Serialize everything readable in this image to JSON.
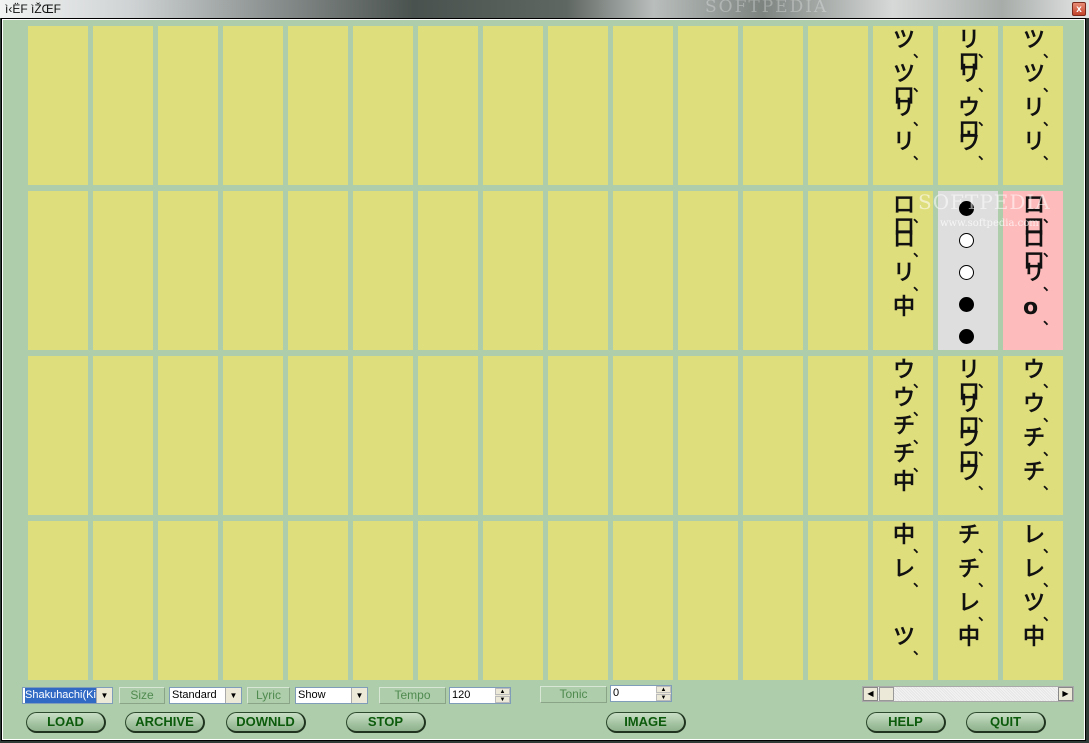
{
  "window": {
    "title": "ì‹ËF ìŽŒF",
    "close_label": "x",
    "watermark": "SOFTPEDIA"
  },
  "grid": {
    "columns": 16,
    "rows": 4,
    "cell_color": "#dfde7c",
    "highlight_colors": {
      "fingering": "#dedede",
      "current": "#febbbb"
    },
    "notation": [
      {
        "row": 0,
        "col": 13,
        "lines": [
          [
            "ツ",
            "、"
          ],
          [
            "ツロ",
            "、"
          ],
          [
            "リ",
            "、"
          ],
          [
            "リ",
            "、"
          ]
        ]
      },
      {
        "row": 0,
        "col": 14,
        "lines": [
          [
            "リロ",
            "、"
          ],
          [
            "リ",
            "、"
          ],
          [
            "ウロ",
            "、"
          ],
          [
            "ウ",
            "、"
          ]
        ]
      },
      {
        "row": 0,
        "col": 15,
        "lines": [
          [
            "ツ",
            "、"
          ],
          [
            "ツ",
            "、"
          ],
          [
            "リ",
            "、"
          ],
          [
            "リ",
            "、"
          ]
        ]
      },
      {
        "row": 1,
        "col": 13,
        "lines": [
          [
            "ロロ",
            "、"
          ],
          [
            "ロ",
            "、"
          ],
          [
            "リ",
            "、"
          ],
          [
            "中",
            ""
          ]
        ]
      },
      {
        "row": 1,
        "col": 15,
        "lines": [
          [
            "ロロ",
            "、"
          ],
          [
            "ロロ",
            "、"
          ],
          [
            "リ",
            "、"
          ],
          [
            "o",
            "、"
          ]
        ]
      },
      {
        "row": 2,
        "col": 13,
        "lines": [
          [
            "ウ",
            "、"
          ],
          [
            "ウ",
            "、"
          ],
          [
            "チ",
            "、"
          ],
          [
            "チ",
            "、"
          ],
          [
            "中",
            ""
          ]
        ]
      },
      {
        "row": 2,
        "col": 14,
        "lines": [
          [
            "リロ",
            "、"
          ],
          [
            "リロ",
            "、"
          ],
          [
            "ウロ",
            "、"
          ],
          [
            "ウ",
            "、"
          ]
        ]
      },
      {
        "row": 2,
        "col": 15,
        "lines": [
          [
            "ウ",
            "、"
          ],
          [
            "ウ",
            "、"
          ],
          [
            "チ",
            "、"
          ],
          [
            "チ",
            "、"
          ]
        ]
      },
      {
        "row": 3,
        "col": 13,
        "lines": [
          [
            "中",
            "、"
          ],
          [
            "レ",
            "、"
          ],
          [
            "",
            ""
          ],
          [
            "ツ",
            "、"
          ]
        ]
      },
      {
        "row": 3,
        "col": 14,
        "lines": [
          [
            "チ",
            "、"
          ],
          [
            "チ",
            "、"
          ],
          [
            "レ",
            "、"
          ],
          [
            "中",
            ""
          ]
        ]
      },
      {
        "row": 3,
        "col": 15,
        "lines": [
          [
            "レ",
            "、"
          ],
          [
            "レ",
            "、"
          ],
          [
            "ツ",
            "、"
          ],
          [
            "中",
            ""
          ]
        ]
      }
    ],
    "fingering_chart": {
      "row": 1,
      "col": 14,
      "holes": [
        "closed",
        "open",
        "open",
        "closed",
        "closed"
      ]
    },
    "current_cell": {
      "row": 1,
      "col": 15
    },
    "watermark": "SOFTPEDIA",
    "watermark_url": "www.softpedia.com"
  },
  "controls": {
    "instrument": {
      "value": "Shakuhachi(Ki"
    },
    "size": {
      "label": "Size",
      "value": "Standard"
    },
    "lyric": {
      "label": "Lyric",
      "value": "Show"
    },
    "tempo": {
      "label": "Tempo",
      "value": "120"
    },
    "tonic": {
      "label": "Tonic",
      "value": "0"
    },
    "scrollbar": {
      "position": 0.0
    }
  },
  "buttons": {
    "load": "LOAD",
    "archive": "ARCHIVE",
    "downld": "DOWNLD",
    "stop": "STOP",
    "image": "IMAGE",
    "help": "HELP",
    "quit": "QUIT"
  }
}
